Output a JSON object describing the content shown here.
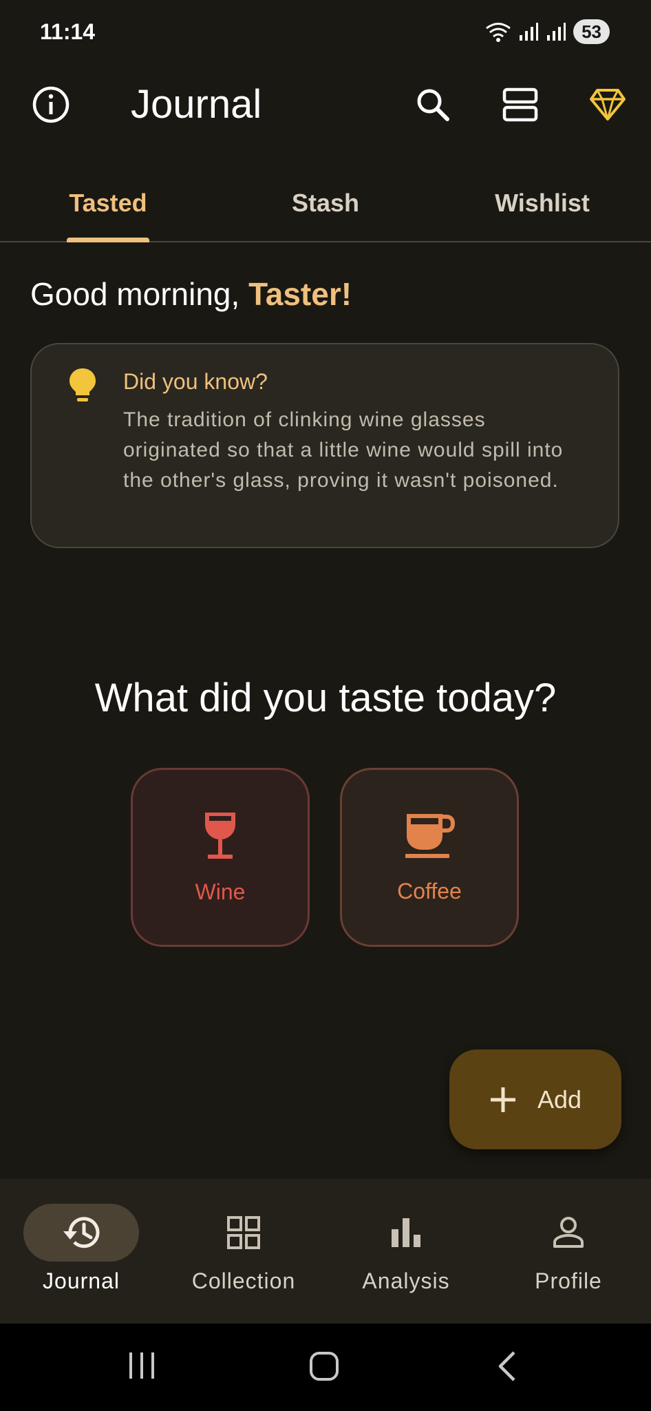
{
  "status_bar": {
    "time": "11:14",
    "battery": "53"
  },
  "app_bar": {
    "title": "Journal",
    "icons": [
      "info-icon",
      "search-icon",
      "view-agenda-icon",
      "diamond-icon"
    ]
  },
  "tabs": [
    {
      "label": "Tasted",
      "active": true
    },
    {
      "label": "Stash",
      "active": false
    },
    {
      "label": "Wishlist",
      "active": false
    }
  ],
  "greeting": {
    "prefix": "Good morning,",
    "name": "Taster!"
  },
  "tip": {
    "title": "Did you know?",
    "body": "The tradition of clinking wine glasses originated so that a little wine would spill into the other's glass, proving it wasn't poisoned."
  },
  "question": "What did you taste today?",
  "categories": [
    {
      "label": "Wine",
      "icon": "wine-glass-icon",
      "color": "#e0584c"
    },
    {
      "label": "Coffee",
      "icon": "coffee-cup-icon",
      "color": "#e2834c"
    }
  ],
  "fab": {
    "label": "Add"
  },
  "bottom_nav": [
    {
      "label": "Journal",
      "icon": "history-icon",
      "active": true
    },
    {
      "label": "Collection",
      "icon": "grid-icon",
      "active": false
    },
    {
      "label": "Analysis",
      "icon": "bar-chart-icon",
      "active": false
    },
    {
      "label": "Profile",
      "icon": "person-icon",
      "active": false
    }
  ],
  "colors": {
    "background": "#1a1812",
    "accent": "#efc07e",
    "fab": "#5b4213"
  }
}
